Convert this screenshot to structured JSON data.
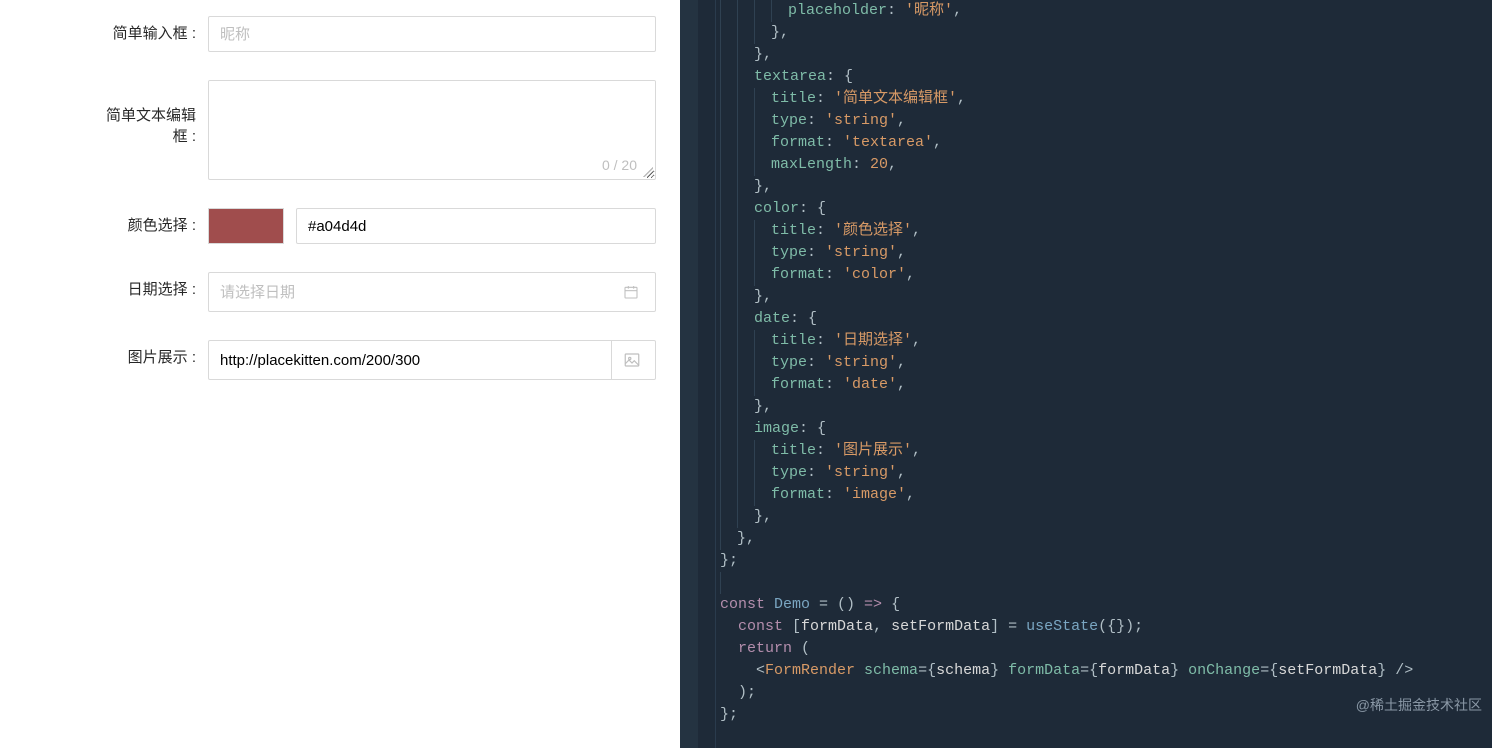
{
  "form": {
    "simple_input": {
      "label": "简单输入框 :",
      "placeholder": "昵称",
      "value": ""
    },
    "textarea": {
      "label": "简单文本编辑\n框 :",
      "value": "",
      "counter": "0 / 20"
    },
    "color": {
      "label": "颜色选择 :",
      "hex": "#a04d4d"
    },
    "date": {
      "label": "日期选择 :",
      "placeholder": "请选择日期",
      "value": ""
    },
    "image": {
      "label": "图片展示 :",
      "value": "http://placekitten.com/200/300"
    }
  },
  "code": {
    "lines": [
      {
        "indent": 3,
        "tokens": [
          [
            "key",
            "placeholder"
          ],
          [
            "punc",
            ": "
          ],
          [
            "str",
            "'昵称'"
          ],
          [
            "punc",
            ","
          ]
        ]
      },
      {
        "indent": 2,
        "tokens": [
          [
            "punc",
            "},"
          ]
        ]
      },
      {
        "indent": 1,
        "tokens": [
          [
            "punc",
            "},"
          ]
        ]
      },
      {
        "indent": 1,
        "tokens": [
          [
            "key",
            "textarea"
          ],
          [
            "punc",
            ": "
          ],
          [
            "punc",
            "{"
          ]
        ]
      },
      {
        "indent": 2,
        "tokens": [
          [
            "key",
            "title"
          ],
          [
            "punc",
            ": "
          ],
          [
            "str",
            "'简单文本编辑框'"
          ],
          [
            "punc",
            ","
          ]
        ]
      },
      {
        "indent": 2,
        "tokens": [
          [
            "key",
            "type"
          ],
          [
            "punc",
            ": "
          ],
          [
            "str",
            "'string'"
          ],
          [
            "punc",
            ","
          ]
        ]
      },
      {
        "indent": 2,
        "tokens": [
          [
            "key",
            "format"
          ],
          [
            "punc",
            ": "
          ],
          [
            "str",
            "'textarea'"
          ],
          [
            "punc",
            ","
          ]
        ]
      },
      {
        "indent": 2,
        "tokens": [
          [
            "key",
            "maxLength"
          ],
          [
            "punc",
            ": "
          ],
          [
            "num",
            "20"
          ],
          [
            "punc",
            ","
          ]
        ]
      },
      {
        "indent": 1,
        "tokens": [
          [
            "punc",
            "},"
          ]
        ]
      },
      {
        "indent": 1,
        "tokens": [
          [
            "key",
            "color"
          ],
          [
            "punc",
            ": "
          ],
          [
            "punc",
            "{"
          ]
        ]
      },
      {
        "indent": 2,
        "tokens": [
          [
            "key",
            "title"
          ],
          [
            "punc",
            ": "
          ],
          [
            "str",
            "'颜色选择'"
          ],
          [
            "punc",
            ","
          ]
        ]
      },
      {
        "indent": 2,
        "tokens": [
          [
            "key",
            "type"
          ],
          [
            "punc",
            ": "
          ],
          [
            "str",
            "'string'"
          ],
          [
            "punc",
            ","
          ]
        ]
      },
      {
        "indent": 2,
        "tokens": [
          [
            "key",
            "format"
          ],
          [
            "punc",
            ": "
          ],
          [
            "str",
            "'color'"
          ],
          [
            "punc",
            ","
          ]
        ]
      },
      {
        "indent": 1,
        "tokens": [
          [
            "punc",
            "},"
          ]
        ]
      },
      {
        "indent": 1,
        "tokens": [
          [
            "key",
            "date"
          ],
          [
            "punc",
            ": "
          ],
          [
            "punc",
            "{"
          ]
        ]
      },
      {
        "indent": 2,
        "tokens": [
          [
            "key",
            "title"
          ],
          [
            "punc",
            ": "
          ],
          [
            "str",
            "'日期选择'"
          ],
          [
            "punc",
            ","
          ]
        ]
      },
      {
        "indent": 2,
        "tokens": [
          [
            "key",
            "type"
          ],
          [
            "punc",
            ": "
          ],
          [
            "str",
            "'string'"
          ],
          [
            "punc",
            ","
          ]
        ]
      },
      {
        "indent": 2,
        "tokens": [
          [
            "key",
            "format"
          ],
          [
            "punc",
            ": "
          ],
          [
            "str",
            "'date'"
          ],
          [
            "punc",
            ","
          ]
        ]
      },
      {
        "indent": 1,
        "tokens": [
          [
            "punc",
            "},"
          ]
        ]
      },
      {
        "indent": 1,
        "tokens": [
          [
            "key",
            "image"
          ],
          [
            "punc",
            ": "
          ],
          [
            "punc",
            "{"
          ]
        ]
      },
      {
        "indent": 2,
        "tokens": [
          [
            "key",
            "title"
          ],
          [
            "punc",
            ": "
          ],
          [
            "str",
            "'图片展示'"
          ],
          [
            "punc",
            ","
          ]
        ]
      },
      {
        "indent": 2,
        "tokens": [
          [
            "key",
            "type"
          ],
          [
            "punc",
            ": "
          ],
          [
            "str",
            "'string'"
          ],
          [
            "punc",
            ","
          ]
        ]
      },
      {
        "indent": 2,
        "tokens": [
          [
            "key",
            "format"
          ],
          [
            "punc",
            ": "
          ],
          [
            "str",
            "'image'"
          ],
          [
            "punc",
            ","
          ]
        ]
      },
      {
        "indent": 1,
        "tokens": [
          [
            "punc",
            "},"
          ]
        ]
      },
      {
        "indent": 0,
        "tokens": [
          [
            "punc",
            "},"
          ]
        ]
      },
      {
        "indent": 0,
        "tokens": [
          [
            "punc",
            "};"
          ]
        ],
        "noindentguide": true
      },
      {
        "indent": 0,
        "tokens": []
      },
      {
        "indent": 0,
        "tokens": [
          [
            "kw",
            "const "
          ],
          [
            "fn",
            "Demo"
          ],
          [
            "punc",
            " = () "
          ],
          [
            "kw",
            "=>"
          ],
          [
            "punc",
            " {"
          ]
        ],
        "noindentguide": true
      },
      {
        "indent": 0,
        "tokens": [
          [
            "punc",
            "  "
          ],
          [
            "kw",
            "const "
          ],
          [
            "punc",
            "["
          ],
          [
            "var",
            "formData"
          ],
          [
            "punc",
            ", "
          ],
          [
            "var",
            "setFormData"
          ],
          [
            "punc",
            "] = "
          ],
          [
            "fn",
            "useState"
          ],
          [
            "punc",
            "({});"
          ]
        ],
        "noindentguide": true
      },
      {
        "indent": 0,
        "tokens": [
          [
            "punc",
            "  "
          ],
          [
            "kw",
            "return"
          ],
          [
            "punc",
            " ("
          ]
        ],
        "noindentguide": true
      },
      {
        "indent": 0,
        "tokens": [
          [
            "punc",
            "    <"
          ],
          [
            "comp",
            "FormRender"
          ],
          [
            "punc",
            " "
          ],
          [
            "attr",
            "schema"
          ],
          [
            "punc",
            "={"
          ],
          [
            "var",
            "schema"
          ],
          [
            "punc",
            "} "
          ],
          [
            "attr",
            "formData"
          ],
          [
            "punc",
            "={"
          ],
          [
            "var",
            "formData"
          ],
          [
            "punc",
            "} "
          ],
          [
            "attr",
            "onChange"
          ],
          [
            "punc",
            "={"
          ],
          [
            "var",
            "setFormData"
          ],
          [
            "punc",
            "} />"
          ]
        ],
        "noindentguide": true
      },
      {
        "indent": 0,
        "tokens": [
          [
            "punc",
            "  );"
          ]
        ],
        "noindentguide": true
      },
      {
        "indent": 0,
        "tokens": [
          [
            "punc",
            "};"
          ]
        ],
        "noindentguide": true
      }
    ]
  },
  "watermark": "@稀土掘金技术社区"
}
